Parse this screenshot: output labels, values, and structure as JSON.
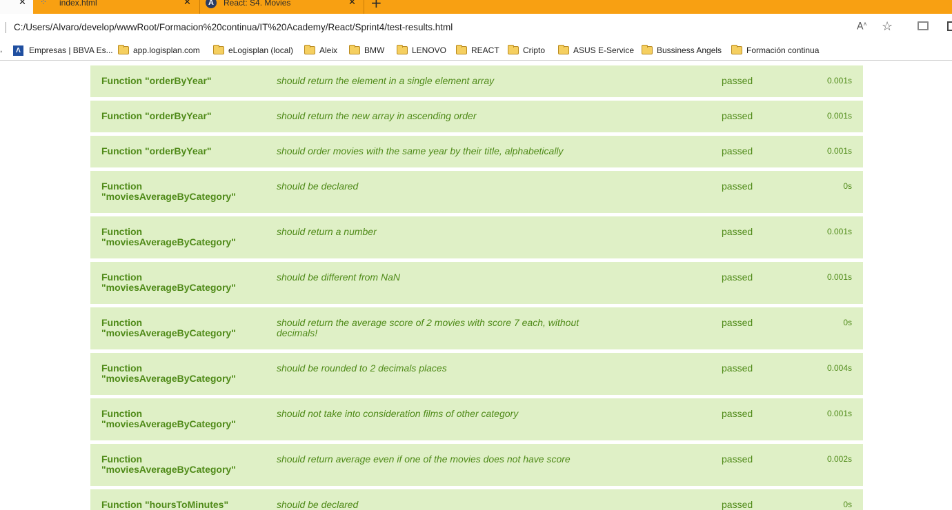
{
  "browser": {
    "tabs": [
      {
        "title": "index.html"
      },
      {
        "title": "React: S4. Movies"
      }
    ],
    "url": "C:/Users/Alvaro/develop/wwwRoot/Formacion%20continua/IT%20Academy/React/Sprint4/test-results.html",
    "bookmarks": [
      {
        "label": "Empresas | BBVA Es...",
        "icon": "bbva-icon"
      },
      {
        "label": "app.logisplan.com",
        "icon": "folder-icon"
      },
      {
        "label": "eLogisplan (local)",
        "icon": "folder-icon"
      },
      {
        "label": "Aleix",
        "icon": "folder-icon"
      },
      {
        "label": "BMW",
        "icon": "folder-icon"
      },
      {
        "label": "LENOVO",
        "icon": "folder-icon"
      },
      {
        "label": "REACT",
        "icon": "folder-icon"
      },
      {
        "label": "Cripto",
        "icon": "folder-icon"
      },
      {
        "label": "ASUS E-Service",
        "icon": "folder-icon"
      },
      {
        "label": "Bussiness Angels",
        "icon": "folder-icon"
      },
      {
        "label": "Formación continua",
        "icon": "folder-icon"
      }
    ]
  },
  "colors": {
    "row_background": "#dff0c6",
    "row_text": "#4f8a18",
    "tabbar": "#f8a012"
  },
  "results": [
    {
      "suite": "Function \"orderByYear\"",
      "description": "should return the element in a single element array",
      "status": "passed",
      "time": "0.001s"
    },
    {
      "suite": "Function \"orderByYear\"",
      "description": "should return the new array in ascending order",
      "status": "passed",
      "time": "0.001s"
    },
    {
      "suite": "Function \"orderByYear\"",
      "description": "should order movies with the same year by their title, alphabetically",
      "status": "passed",
      "time": "0.001s"
    },
    {
      "suite": "Function \"moviesAverageByCategory\"",
      "description": "should be declared",
      "status": "passed",
      "time": "0s"
    },
    {
      "suite": "Function \"moviesAverageByCategory\"",
      "description": "should return a number",
      "status": "passed",
      "time": "0.001s"
    },
    {
      "suite": "Function \"moviesAverageByCategory\"",
      "description": "should be different from NaN",
      "status": "passed",
      "time": "0.001s"
    },
    {
      "suite": "Function \"moviesAverageByCategory\"",
      "description": "should return the average score of 2 movies with score 7 each, without decimals!",
      "status": "passed",
      "time": "0s"
    },
    {
      "suite": "Function \"moviesAverageByCategory\"",
      "description": "should be rounded to 2 decimals places",
      "status": "passed",
      "time": "0.004s"
    },
    {
      "suite": "Function \"moviesAverageByCategory\"",
      "description": "should not take into consideration films of other category",
      "status": "passed",
      "time": "0.001s"
    },
    {
      "suite": "Function \"moviesAverageByCategory\"",
      "description": "should return average even if one of the movies does not have score",
      "status": "passed",
      "time": "0.002s"
    },
    {
      "suite": "Function \"hoursToMinutes\"",
      "description": "should be declared",
      "status": "passed",
      "time": "0s"
    }
  ]
}
